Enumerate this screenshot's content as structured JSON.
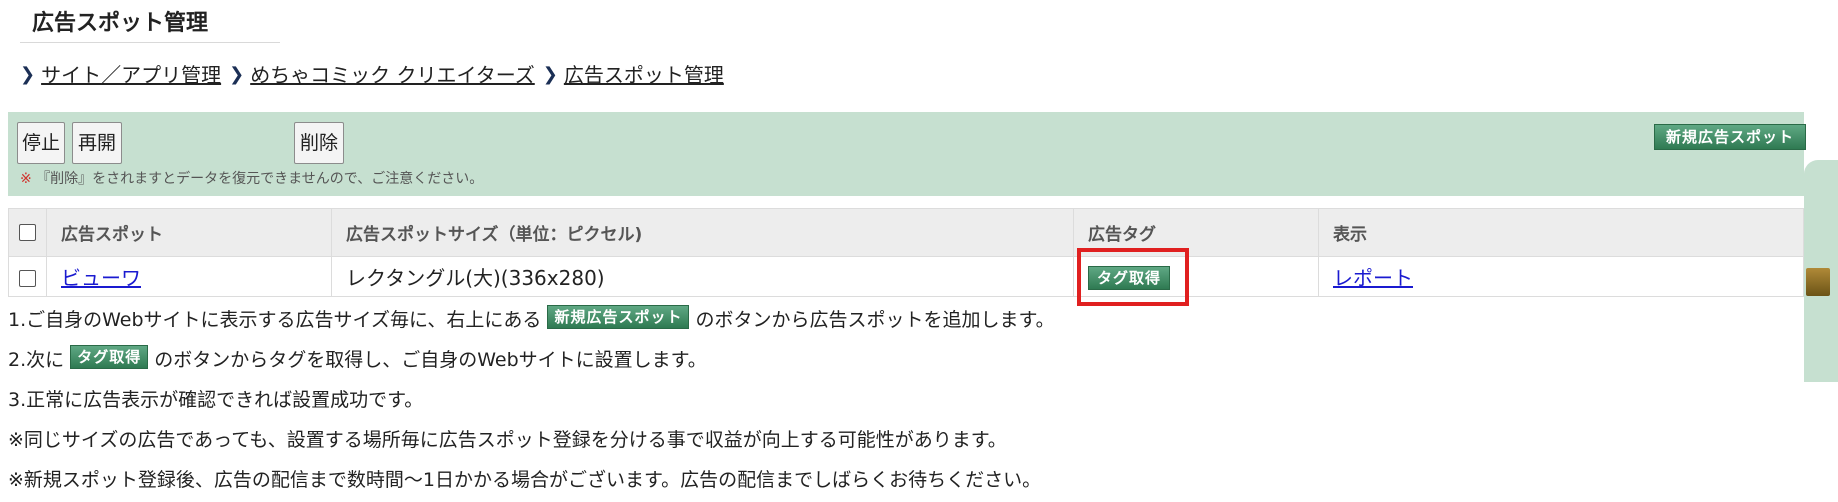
{
  "page": {
    "title": "広告スポット管理"
  },
  "breadcrumb": [
    {
      "label": "サイト／アプリ管理"
    },
    {
      "label": "めちゃコミック クリエイターズ"
    },
    {
      "label": "広告スポット管理"
    }
  ],
  "toolbar": {
    "stop_label": "停止",
    "resume_label": "再開",
    "delete_label": "削除",
    "new_spot_label": "新規広告スポット",
    "warning_mark": "※",
    "warning_text": "『削除』をされますとデータを復元できませんので、ご注意ください。"
  },
  "table": {
    "headers": [
      "広告スポット",
      "広告スポットサイズ（単位：ピクセル)",
      "広告タグ",
      "表示"
    ],
    "rows": [
      {
        "spot": "ビューワ",
        "size": "レクタングル(大)(336x280)",
        "tag_button": "タグ取得",
        "report": "レポート"
      }
    ]
  },
  "instructions": {
    "line1_pre": "1.ご自身のWebサイトに表示する広告サイズ毎に、右上にある",
    "line1_btn": "新規広告スポット",
    "line1_post": "のボタンから広告スポットを追加します。",
    "line2_pre": "2.次に",
    "line2_btn": "タグ取得",
    "line2_post": "のボタンからタグを取得し、ご自身のWebサイトに設置します。",
    "line3": "3.正常に広告表示が確認できれば設置成功です。",
    "line4": "※同じサイズの広告であっても、設置する場所毎に広告スポット登録を分ける事で収益が向上する可能性があります。",
    "line5": "※新規スポット登録後、広告の配信まで数時間～1日かかる場合がございます。広告の配信までしばらくお待ちください。"
  },
  "colors": {
    "toolbar_bg": "#c6e0d0",
    "accent_green": "#2f7a52",
    "highlight_red": "#e02020",
    "link_blue": "#1a1ad0"
  }
}
